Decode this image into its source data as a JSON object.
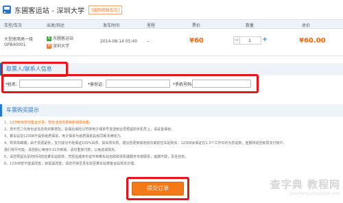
{
  "route": {
    "title": "东圃客运站 - 深圳大学",
    "change_link": "[返回修改车次]"
  },
  "table": {
    "headers": {
      "line": "车型/车次",
      "stations": "出发/到达",
      "time": "发车时间",
      "distance": "里程",
      "price": "票价",
      "quantity": "数量",
      "total": "总价"
    },
    "row": {
      "vehicle_type": "大型座席高一级",
      "vehicle_no": "OPB40001",
      "departure_tag": "发",
      "departure": "东圃客运站",
      "arrival_tag": "到",
      "arrival": "深圳大学",
      "time": "2014-08-14 05:40",
      "distance": "--",
      "price": "¥60",
      "minus": "−",
      "quantity": "1",
      "plus": "+",
      "total": "¥60.00"
    }
  },
  "passenger": {
    "section_title": "取票人/联系人信息",
    "name_label": "*姓名:",
    "id_label": "*身份证:",
    "phone_label": "*手机号码:",
    "name_value": "",
    "id_value": "",
    "phone_value": ""
  },
  "notice": {
    "section_title": "车票购买提示",
    "items": [
      "1、12308目前仅售全价票，暂无活动优惠和折扣票出售。",
      "2、您可凭二代身份证信息购买乘意险，投保后保险公司将电子保单号发送到合员预留的手机号上，请妥善保管。",
      "3、乘车站及12308不提供纸质保单，电子保单与纸质保单具有同等法律效力。",
      "4、购票高峰期，由于票源紧张，支付成功不能保证100%出票。如出票失败，建议您更换其他班次或前往车站购买，12308会保证在1-3个工作日内为您退款，金额将返回到原支付账户。",
      "   我们将尽可能，请您耐心等待3-21内到账。请勿重复付款，以免造成损失。",
      "5、请您预留充足的时间前往乘车站取票，凭短信或身份证件到乘车站自助取票机或服务专窗取票，逾期不取，责任自负。",
      "6、12308暂不能退改签，如需退改签，请您尽快至发车前至乘车站按客运站规定办理。"
    ]
  },
  "submit": {
    "label": "提交订单"
  },
  "watermark": {
    "main": "查字典 教程网",
    "sub": "jiaocheng.chazidian.com"
  },
  "colors": {
    "accent_blue": "#2a78c8",
    "price_orange": "#ff6600",
    "highlight_red": "#e8141b",
    "submit_orange": "#f27a1a"
  }
}
